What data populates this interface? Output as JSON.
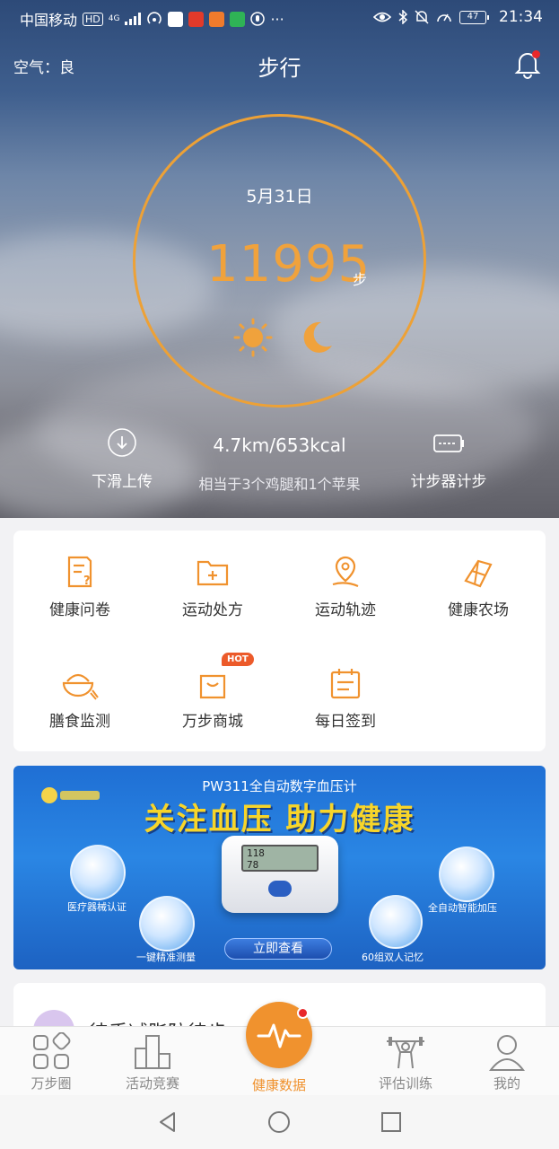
{
  "status_bar": {
    "carrier": "中国移动",
    "hd": "HD",
    "network": "4G",
    "battery": "47",
    "time": "21:34"
  },
  "header": {
    "air_quality": "空气：良",
    "title": "步行",
    "bell_icon": "bell-icon"
  },
  "summary": {
    "date": "5月31日",
    "steps": "11995",
    "steps_unit": "步",
    "distance_kcal": "4.7km/653kcal",
    "equivalent": "相当于3个鸡腿和1个苹果",
    "pull_upload": "下滑上传",
    "pedometer": "计步器计步"
  },
  "features": {
    "items": [
      {
        "label": "健康问卷",
        "icon": "questionnaire-icon"
      },
      {
        "label": "运动处方",
        "icon": "prescription-folder-icon"
      },
      {
        "label": "运动轨迹",
        "icon": "location-track-icon"
      },
      {
        "label": "健康农场",
        "icon": "farm-icon"
      },
      {
        "label": "膳食监测",
        "icon": "bowl-icon"
      },
      {
        "label": "万步商城",
        "icon": "shopping-bag-icon"
      },
      {
        "label": "每日签到",
        "icon": "calendar-icon"
      }
    ],
    "hot_badge": "HOT"
  },
  "banner": {
    "subtitle": "PW311全自动数字血压计",
    "headline": "关注血压 助力健康",
    "features": [
      "医疗器械认证",
      "一键精准测量",
      "60组双人记忆",
      "全自动智能加压"
    ],
    "cta": "立即查看",
    "device_reading": [
      "118",
      "78"
    ]
  },
  "next_card": {
    "text": "徒手减脂防徒步"
  },
  "bottom_nav": {
    "items": [
      "万步圈",
      "活动竞赛",
      "健康数据",
      "评估训练",
      "我的"
    ]
  },
  "colors": {
    "accent": "#f0922e",
    "ring": "#eda136",
    "notification": "#e8282b"
  }
}
